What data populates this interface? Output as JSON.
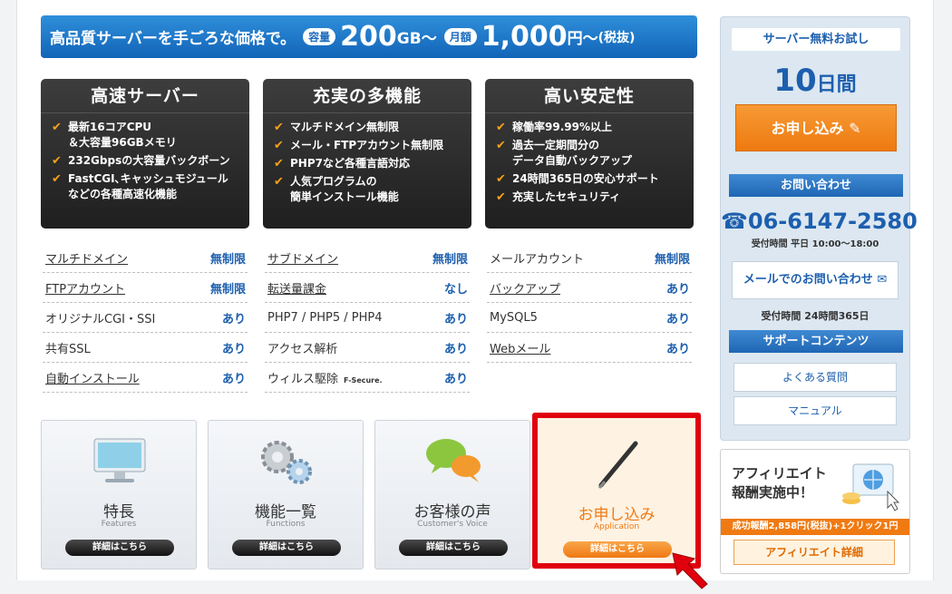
{
  "banner": {
    "lead": "高品質サーバーを手ごろな価格で。",
    "capacity_tag": "容量",
    "capacity_value": "200",
    "capacity_unit": "GB〜",
    "price_tag": "月額",
    "price_value": "1,000",
    "price_unit": "円〜",
    "tax_note": "(税抜)"
  },
  "features": [
    {
      "title": "高速サーバー",
      "items": [
        "最新16コアCPU\n＆大容量96GBメモリ",
        "232Gbpsの大容量バックボーン",
        "FastCGI､キャッシュモジュール\nなどの各種高速化機能"
      ]
    },
    {
      "title": "充実の多機能",
      "items": [
        "マルチドメイン無制限",
        "メール・FTPアカウント無制限",
        "PHP7など各種言語対応",
        "人気プログラムの\n簡単インストール機能"
      ]
    },
    {
      "title": "高い安定性",
      "items": [
        "稼働率99.99%以上",
        "過去一定期間分の\nデータ自動バックアップ",
        "24時間365日の安心サポート",
        "充実したセキュリティ"
      ]
    }
  ],
  "spec": {
    "col1": [
      {
        "k": "マルチドメイン",
        "v": "無制限"
      },
      {
        "k": "FTPアカウント",
        "v": "無制限"
      },
      {
        "k": "オリジナルCGI・SSI",
        "v": "あり"
      },
      {
        "k": "共有SSL",
        "v": "あり"
      },
      {
        "k": "自動インストール",
        "v": "あり"
      }
    ],
    "col2": [
      {
        "k": "サブドメイン",
        "v": "無制限"
      },
      {
        "k": "転送量課金",
        "v": "なし"
      },
      {
        "k": "PHP7 / PHP5 / PHP4",
        "v": "あり"
      },
      {
        "k": "アクセス解析",
        "v": "あり"
      },
      {
        "k": "ウィルス駆除",
        "v": "あり",
        "badge": "F-Secure."
      }
    ],
    "col3": [
      {
        "k": "メールアカウント",
        "v": "無制限"
      },
      {
        "k": "バックアップ",
        "v": "あり"
      },
      {
        "k": "MySQL5",
        "v": "あり"
      },
      {
        "k": "Webメール",
        "v": "あり"
      }
    ]
  },
  "cards": [
    {
      "title": "特長",
      "sub": "Features",
      "btn": "詳細はこちら"
    },
    {
      "title": "機能一覧",
      "sub": "Functions",
      "btn": "詳細はこちら"
    },
    {
      "title": "お客様の声",
      "sub": "Customer's Voice",
      "btn": "詳細はこちら"
    },
    {
      "title": "お申し込み",
      "sub": "Application",
      "btn": "詳細はこちら"
    }
  ],
  "sidebar": {
    "trial_tag": "サーバー無料お試し",
    "trial_days_num": "10",
    "trial_days_unit": "日間",
    "apply_label": "お申し込み",
    "contact_head": "お問い合わせ",
    "phone": "06-6147-2580",
    "phone_hours": "受付時間 平日 10:00〜18:00",
    "mail_label": "メールでのお問い合わせ",
    "mail_hours": "受付時間 24時間365日",
    "support_head": "サポートコンテンツ",
    "faq_label": "よくある質問",
    "manual_label": "マニュアル"
  },
  "affiliate": {
    "title_line1": "アフィリエイト",
    "title_line2": "報酬実施中！",
    "strip": "成功報酬2,858円(税抜)+1クリック1円",
    "btn": "アフィリエイト詳細"
  },
  "colors": {
    "accent_blue": "#1d5fae",
    "accent_orange": "#f07a12",
    "highlight_red": "#e0000e"
  }
}
